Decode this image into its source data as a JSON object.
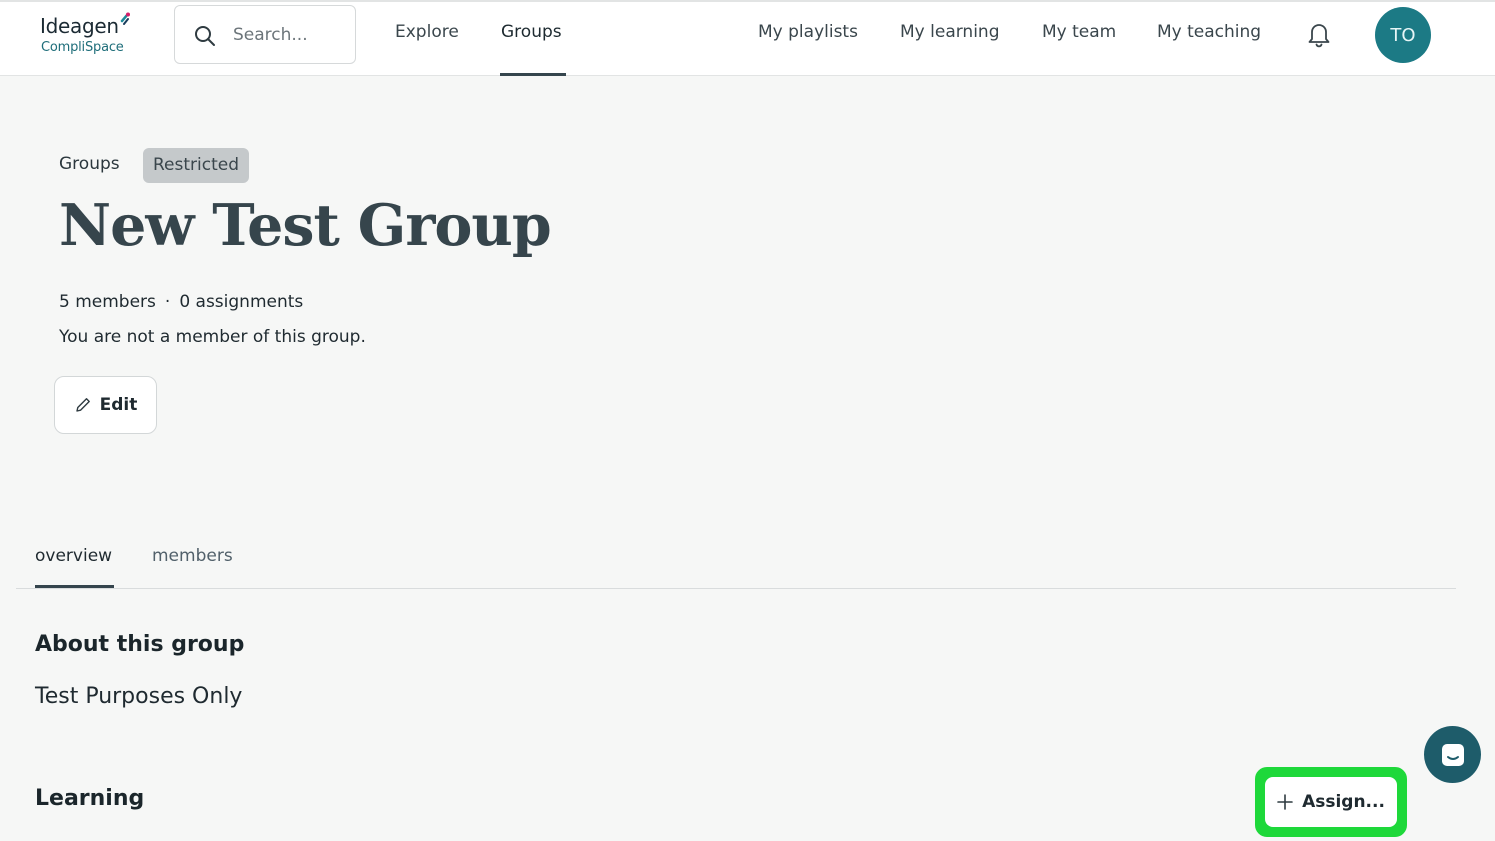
{
  "brand": {
    "name_top": "Ideagen",
    "name_bottom": "CompliSpace"
  },
  "search": {
    "placeholder": "Search..."
  },
  "nav": {
    "primary": [
      {
        "label": "Explore",
        "active": false
      },
      {
        "label": "Groups",
        "active": true
      }
    ],
    "secondary": [
      {
        "label": "My playlists"
      },
      {
        "label": "My learning"
      },
      {
        "label": "My team"
      },
      {
        "label": "My teaching"
      }
    ],
    "notifications_icon": "bell-icon",
    "avatar_initials": "TO",
    "avatar_color": "#1c7a85"
  },
  "header": {
    "breadcrumb": "Groups",
    "badge": "Restricted",
    "title": "New Test Group",
    "members_count": "5 members",
    "separator": "·",
    "assignments_count": "0 assignments",
    "membership_note": "You are not a member of this group.",
    "edit_label": "Edit"
  },
  "tabs": [
    {
      "label": "overview",
      "active": true
    },
    {
      "label": "members",
      "active": false
    }
  ],
  "about": {
    "title": "About this group",
    "text": "Test Purposes Only"
  },
  "learning": {
    "title": "Learning",
    "assign_label": "Assign...",
    "highlight_color": "#1ed83a"
  },
  "chat": {
    "icon": "chat-icon"
  }
}
